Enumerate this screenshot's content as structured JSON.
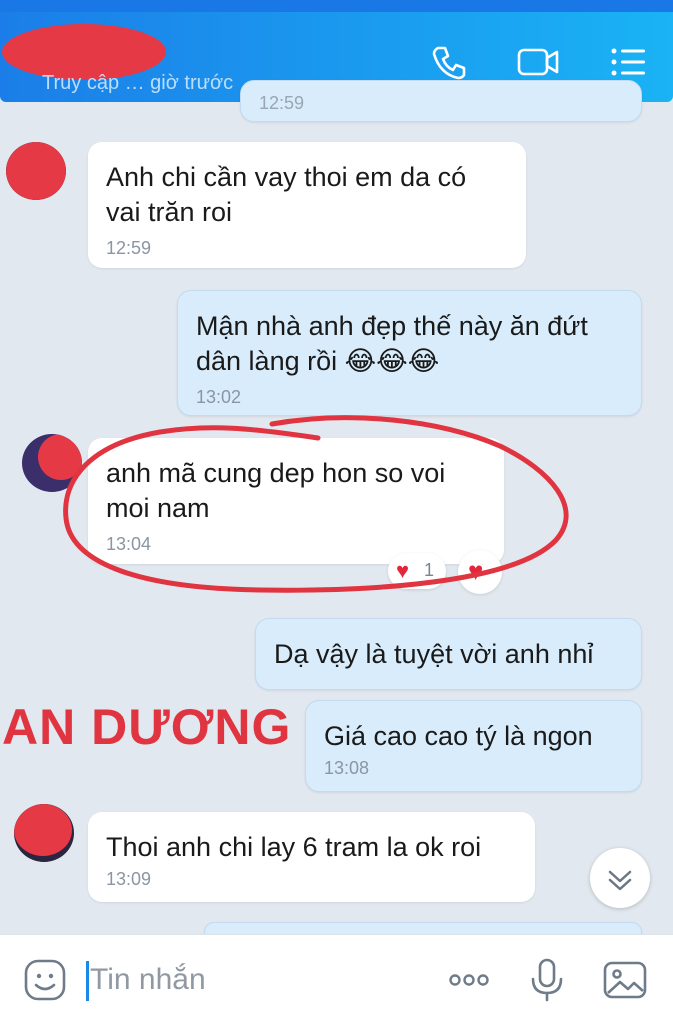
{
  "header": {
    "subtitle": "Truy cập … giờ trước",
    "call_icon": "phone-icon",
    "video_icon": "video-call-icon",
    "menu_icon": "menu-list-icon"
  },
  "messages": [
    {
      "time": "12:59"
    },
    {
      "text": "Anh chi cần vay thoi em da có vai trăn roi",
      "time": "12:59"
    },
    {
      "text": "Mận nhà anh đẹp thế này ăn đứt dân làng rồi 😂😂😂",
      "time": "13:02"
    },
    {
      "text": "anh mã cung dep hon so voi moi nam",
      "time": "13:04",
      "reaction_count": "1"
    },
    {
      "text": "Dạ vậy là tuyệt vời anh nhỉ"
    },
    {
      "text": "Giá cao cao tý là ngon",
      "time": "13:08"
    },
    {
      "text": "Thoi anh chi lay 6 tram la ok roi",
      "time": "13:09"
    }
  ],
  "watermark": "AN DƯƠNG",
  "composer": {
    "placeholder": "Tin nhắn",
    "emoji_icon": "emoji-icon",
    "more_icon": "more-dots-icon",
    "mic_icon": "microphone-icon",
    "image_icon": "image-icon"
  },
  "colors": {
    "header": "#1b7ee8",
    "outgoing": "#d8ecfb",
    "annotation": "#e03441"
  }
}
